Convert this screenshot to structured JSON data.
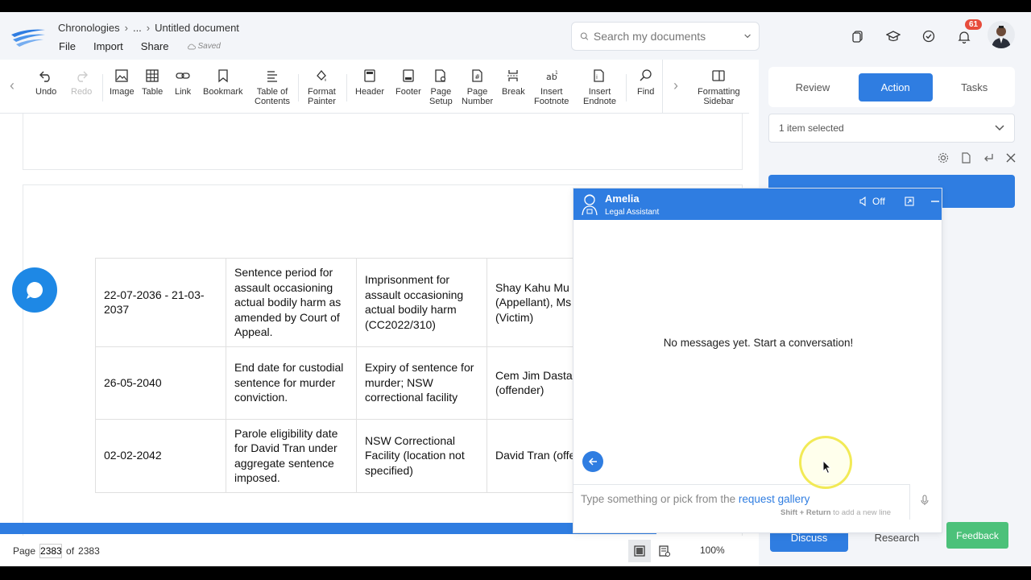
{
  "header": {
    "breadcrumb": [
      "Chronologies",
      "...",
      "Untitled document"
    ],
    "menu": [
      "File",
      "Import",
      "Share"
    ],
    "saved_label": "Saved",
    "search_placeholder": "Search my documents",
    "notification_count": "61"
  },
  "toolbar": {
    "tools": [
      {
        "label": "Undo",
        "icon": "undo-icon"
      },
      {
        "label": "Redo",
        "icon": "redo-icon"
      },
      {
        "label": "Image",
        "icon": "image-icon"
      },
      {
        "label": "Table",
        "icon": "table-icon"
      },
      {
        "label": "Link",
        "icon": "link-icon"
      },
      {
        "label": "Bookmark",
        "icon": "bookmark-icon"
      },
      {
        "label": "Table of\nContents",
        "icon": "toc-icon"
      },
      {
        "label": "Format\nPainter",
        "icon": "format-painter-icon"
      },
      {
        "label": "Header",
        "icon": "header-icon"
      },
      {
        "label": "Footer",
        "icon": "footer-icon"
      },
      {
        "label": "Page\nSetup",
        "icon": "page-setup-icon"
      },
      {
        "label": "Page\nNumber",
        "icon": "page-number-icon"
      },
      {
        "label": "Break",
        "icon": "break-icon"
      },
      {
        "label": "Insert\nFootnote",
        "icon": "footnote-icon"
      },
      {
        "label": "Insert\nEndnote",
        "icon": "endnote-icon"
      },
      {
        "label": "Find",
        "icon": "find-icon"
      },
      {
        "label": "Formatting\nSidebar",
        "icon": "sidebar-icon"
      }
    ]
  },
  "document": {
    "rows": [
      [
        "22-07-2036 - 21-03-2037",
        "Sentence period for assault occasioning actual bodily harm as amended by Court of Appeal.",
        "Imprisonment for assault occasioning actual bodily harm (CC2022/310)",
        "Shay Kahu Mu (Appellant), Ms (Victim)"
      ],
      [
        "26-05-2040",
        "End date for custodial sentence for murder conviction.",
        "Expiry of sentence for murder; NSW correctional facility",
        "Cem Jim Dasta (offender)"
      ],
      [
        "02-02-2042",
        "Parole eligibility date for David Tran under aggregate sentence imposed.",
        "NSW Correctional Facility (location not specified)",
        "David Tran (offender)"
      ]
    ]
  },
  "status": {
    "page_label": "Page",
    "page_current": "2383",
    "of_label": "of",
    "page_total": "2383",
    "zoom": "100%"
  },
  "panel": {
    "tabs": [
      "Review",
      "Action",
      "Tasks"
    ],
    "active_tab": "Action",
    "selection": "1 item selected",
    "bottom_tabs": [
      "Discuss",
      "Research"
    ],
    "feedback": "Feedback"
  },
  "chat": {
    "name": "Amelia",
    "role": "Legal Assistant",
    "sound": "Off",
    "empty": "No messages yet. Start a conversation!",
    "input_prefix": "Type something or pick from the ",
    "input_link": "request gallery",
    "hint_keys": "Shift + Return",
    "hint_text": " to add a new line"
  },
  "colors": {
    "accent": "#2f7de1",
    "feedback": "#4cc17a",
    "badge": "#e74c3c"
  }
}
